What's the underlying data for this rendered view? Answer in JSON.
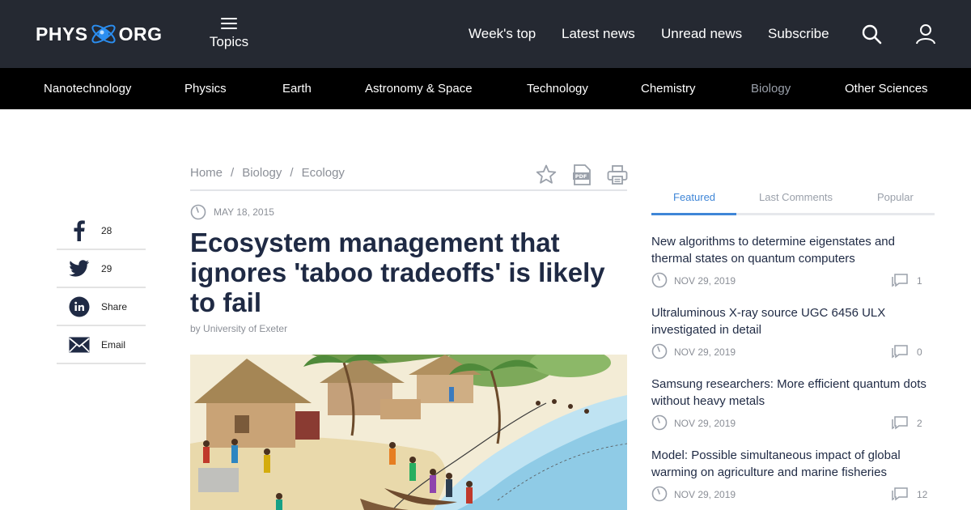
{
  "header": {
    "logo_left": "PHYS",
    "logo_right": "ORG",
    "topics_label": "Topics",
    "nav": [
      "Week's top",
      "Latest news",
      "Unread news",
      "Subscribe"
    ],
    "icons": [
      "search-icon",
      "user-icon"
    ]
  },
  "categories": {
    "items": [
      "Nanotechnology",
      "Physics",
      "Earth",
      "Astronomy & Space",
      "Technology",
      "Chemistry",
      "Biology",
      "Other Sciences"
    ],
    "active": "Biology"
  },
  "share": [
    {
      "icon": "facebook-icon",
      "value": "28"
    },
    {
      "icon": "twitter-icon",
      "value": "29"
    },
    {
      "icon": "linkedin-icon",
      "value": "Share"
    },
    {
      "icon": "email-icon",
      "value": "Email"
    }
  ],
  "breadcrumb": [
    "Home",
    "Biology",
    "Ecology"
  ],
  "breadcrumb_separator": "/",
  "tools": [
    "bookmark-star-icon",
    "pdf-icon",
    "print-icon"
  ],
  "article": {
    "date": "MAY 18, 2015",
    "headline": "Ecosystem management that ignores 'taboo tradeoffs' is likely to fail",
    "by": "by",
    "source": "University of Exeter",
    "image": "illustration of a coastal village with huts, palm trees and people pulling fishing nets from the sea"
  },
  "sidebar": {
    "tabs": [
      "Featured",
      "Last Comments",
      "Popular"
    ],
    "active_tab": "Featured",
    "items": [
      {
        "title": "New algorithms to determine eigenstates and thermal states on quantum computers",
        "date": "NOV 29, 2019",
        "comments": "1"
      },
      {
        "title": "Ultraluminous X-ray source UGC 6456 ULX investigated in detail",
        "date": "NOV 29, 2019",
        "comments": "0"
      },
      {
        "title": "Samsung researchers: More efficient quantum dots without heavy metals",
        "date": "NOV 29, 2019",
        "comments": "2"
      },
      {
        "title": "Model: Possible simultaneous impact of global warming on agriculture and marine fisheries",
        "date": "NOV 29, 2019",
        "comments": "12"
      }
    ]
  },
  "colors": {
    "header_bg": "#252932",
    "category_bg": "#000000",
    "accent": "#3f86d7",
    "headline": "#1f2a44",
    "muted": "#8b8f97"
  }
}
